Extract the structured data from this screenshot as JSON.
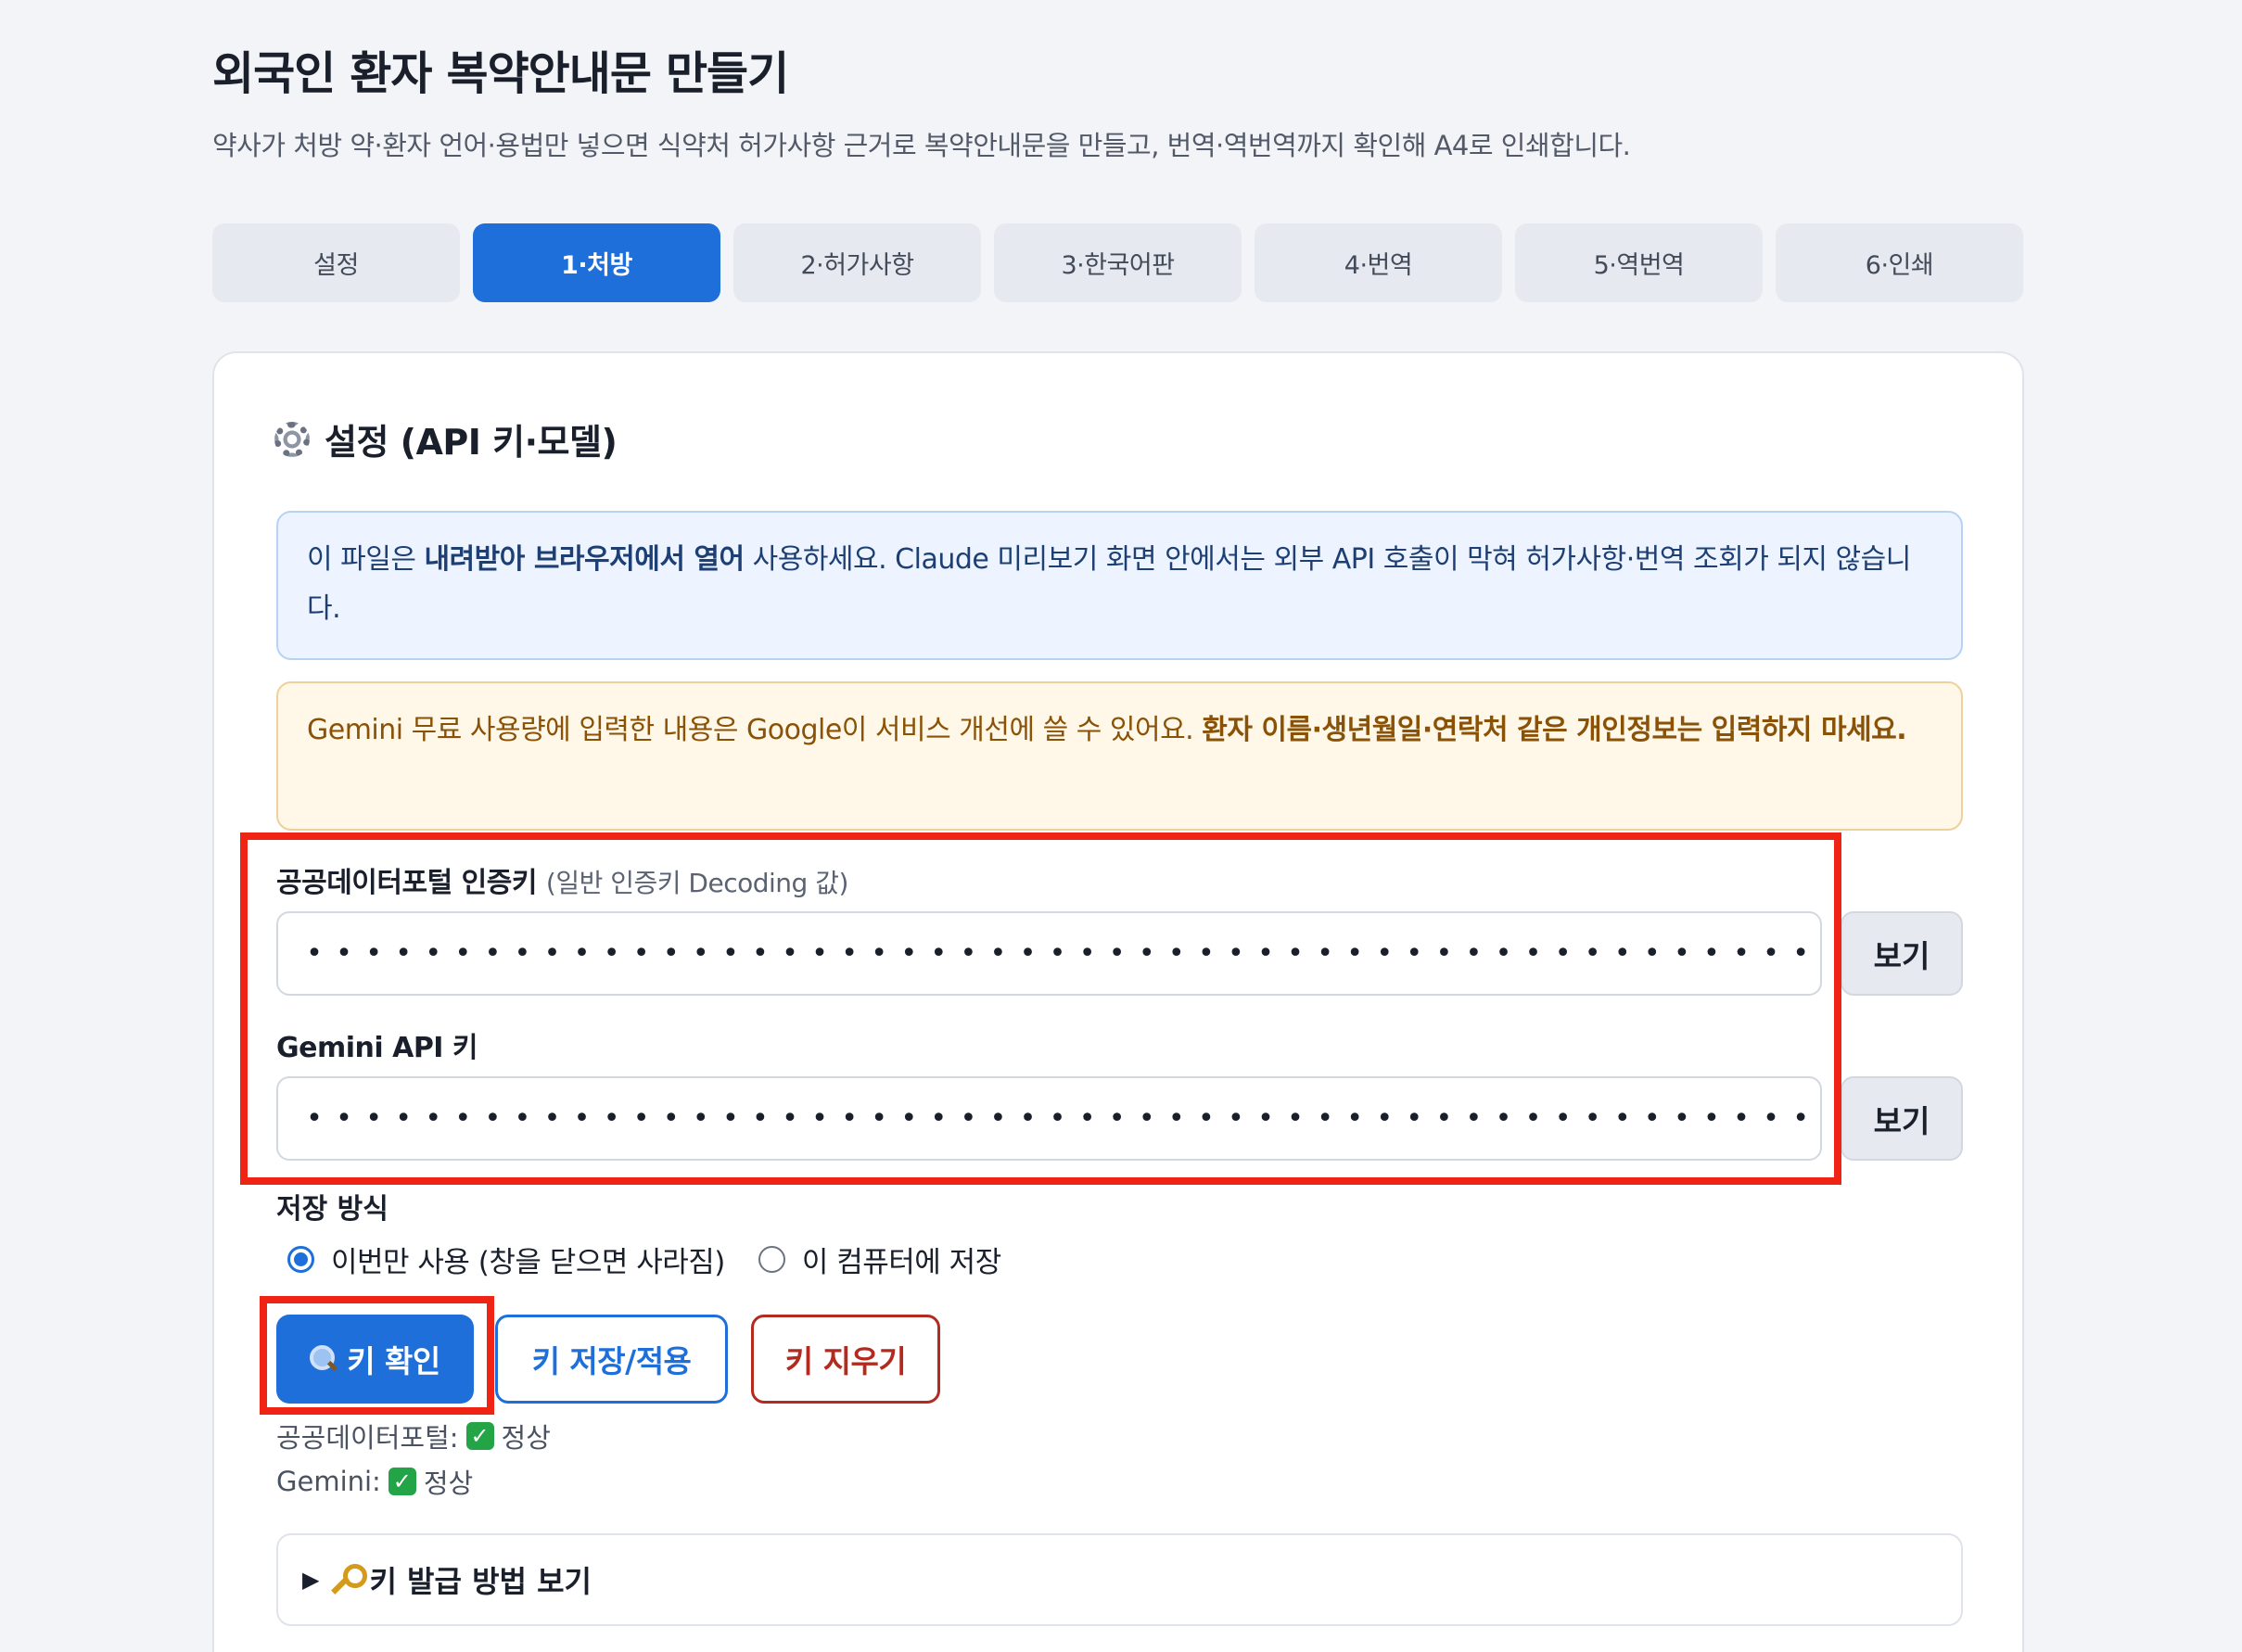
{
  "header": {
    "title": "외국인 환자 복약안내문 만들기",
    "subtitle": "약사가 처방 약·환자 언어·용법만 넣으면 식약처 허가사항 근거로 복약안내문을 만들고, 번역·역번역까지 확인해 A4로 인쇄합니다."
  },
  "tabs": [
    {
      "label": "설정",
      "active": false
    },
    {
      "label": "1·처방",
      "active": true
    },
    {
      "label": "2·허가사항",
      "active": false
    },
    {
      "label": "3·한국어판",
      "active": false
    },
    {
      "label": "4·번역",
      "active": false
    },
    {
      "label": "5·역번역",
      "active": false
    },
    {
      "label": "6·인쇄",
      "active": false
    }
  ],
  "settings": {
    "title": "설정 (API 키·모델)",
    "info_notice": {
      "before": "이 파일은 ",
      "bold": "내려받아 브라우저에서 열어",
      "after": " 사용하세요. Claude 미리보기 화면 안에서는 외부 API 호출이 막혀 허가사항·번역 조회가 되지 않습니다."
    },
    "warn_notice": {
      "before": "Gemini 무료 사용량에 입력한 내용은 Google이 서비스 개선에 쓸 수 있어요. ",
      "bold": "환자 이름·생년월일·연락처 같은 개인정보는 입력하지 마세요."
    },
    "public_key": {
      "label": "공공데이터포털 인증키",
      "hint": "(일반 인증키 Decoding 값)",
      "value": "••••••••••••••••••••••••••••••••••••••••••••••••••••••••",
      "show_label": "보기"
    },
    "gemini_key": {
      "label": "Gemini API 키",
      "value": "••••••••••••••••••••••••••••••••••••••••••••••••••••••••",
      "show_label": "보기"
    },
    "storage": {
      "label": "저장 방식",
      "options": [
        {
          "label": "이번만 사용 (창을 닫으면 사라짐)",
          "checked": true
        },
        {
          "label": "이 컴퓨터에 저장",
          "checked": false
        }
      ]
    },
    "buttons": {
      "check": "키 확인",
      "save": "키 저장/적용",
      "clear": "키 지우기"
    },
    "status": [
      {
        "label": "공공데이터포털:",
        "value": "정상"
      },
      {
        "label": "Gemini:",
        "value": "정상"
      }
    ],
    "details_label": "키 발급 방법 보기"
  },
  "colors": {
    "accent": "#1f6fdb",
    "danger": "#b32a1f",
    "highlight": "#f02415",
    "ok": "#22a447"
  }
}
